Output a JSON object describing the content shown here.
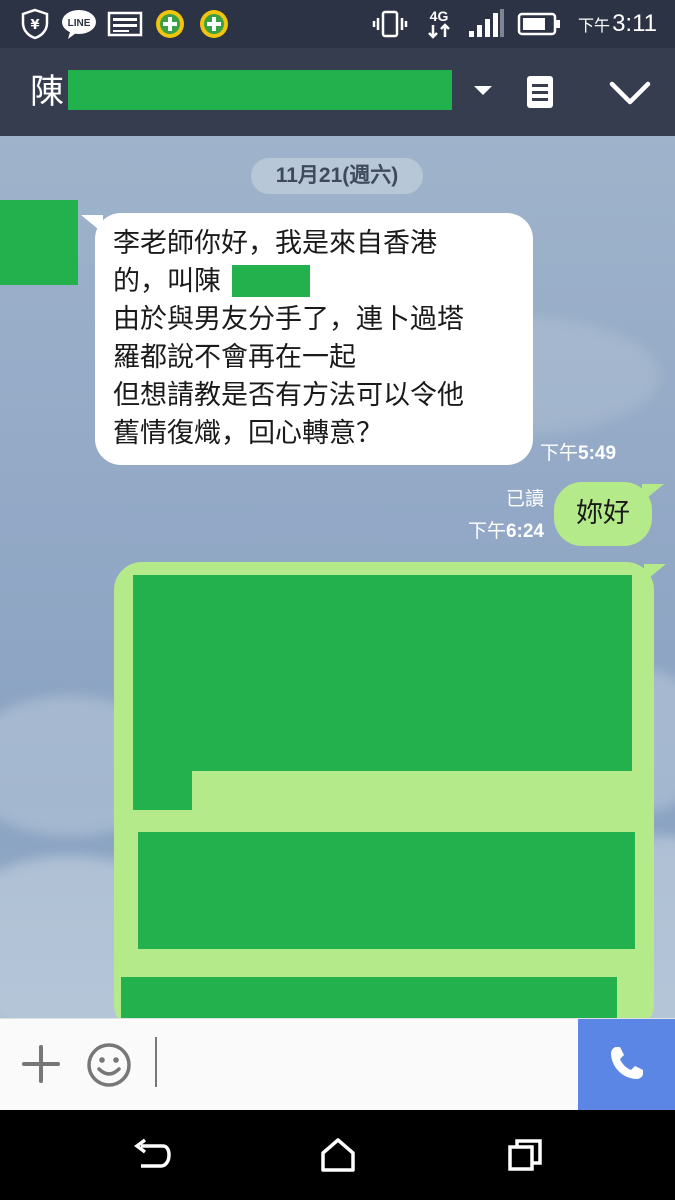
{
  "status_bar": {
    "time_prefix": "下午",
    "time": "3:11",
    "network": "4G",
    "line_badge": "LINE",
    "icons": [
      "shield-yen-icon",
      "line-app-icon",
      "image-notification-icon",
      "green-plus-icon",
      "green-plus-icon",
      "vibrate-icon",
      "signal-icon",
      "battery-icon"
    ]
  },
  "header": {
    "contact_name_visible": "陳",
    "icons": [
      "dropdown-arrow-icon",
      "notes-icon",
      "chevron-down-icon"
    ]
  },
  "chat": {
    "date_divider": "11月21(週六)",
    "messages": [
      {
        "direction": "incoming",
        "lines": [
          "李老師你好，我是來自香港",
          "的，叫陳",
          "由於與男友分手了，連卜過塔",
          "羅都說不會再在一起",
          "但想請教是否有方法可以令他",
          "舊情復熾，回心轉意？"
        ],
        "time_prefix": "下午",
        "time": "5:49"
      },
      {
        "direction": "outgoing",
        "text": "妳好",
        "read_label": "已讀",
        "time_prefix": "下午",
        "time": "6:24"
      },
      {
        "direction": "outgoing",
        "text": "",
        "redacted": true
      }
    ]
  },
  "input_bar": {
    "placeholder": "",
    "icons": [
      "plus-icon",
      "emoji-icon",
      "phone-call-icon"
    ]
  },
  "nav_bar": {
    "icons": [
      "back-icon",
      "home-icon",
      "recents-icon"
    ]
  },
  "colors": {
    "status_bar_bg": "#2c3344",
    "title_bar_bg": "#353d4f",
    "chat_bg": "#93a9c6",
    "incoming_bubble": "#ffffff",
    "outgoing_bubble": "#b5ea8b",
    "redaction": "#22b14c",
    "call_button": "#5b86e5"
  }
}
